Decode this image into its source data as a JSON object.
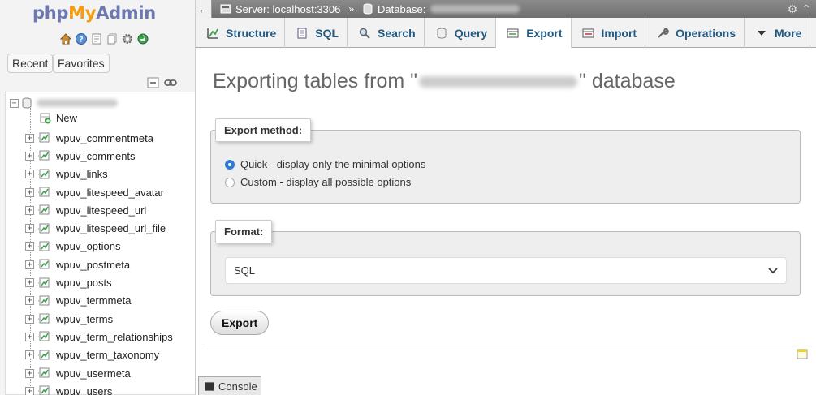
{
  "logo": {
    "php": "php",
    "my": "My",
    "admin": "Admin"
  },
  "quick_icons": [
    "home-icon",
    "help-icon",
    "docs-icon",
    "copy-icon",
    "settings-icon",
    "reload-icon"
  ],
  "nav": {
    "recent_label": "Recent",
    "favorites_label": "Favorites",
    "new_label": "New",
    "tables": [
      "wpuv_commentmeta",
      "wpuv_comments",
      "wpuv_links",
      "wpuv_litespeed_avatar",
      "wpuv_litespeed_url",
      "wpuv_litespeed_url_file",
      "wpuv_options",
      "wpuv_postmeta",
      "wpuv_posts",
      "wpuv_termmeta",
      "wpuv_terms",
      "wpuv_term_relationships",
      "wpuv_term_taxonomy",
      "wpuv_usermeta",
      "wpuv_users"
    ]
  },
  "breadcrumb": {
    "server": "Server: localhost:3306",
    "separator": "»",
    "database": "Database:"
  },
  "tabs": [
    {
      "label": "Structure",
      "icon": "structure-icon"
    },
    {
      "label": "SQL",
      "icon": "sql-icon"
    },
    {
      "label": "Search",
      "icon": "search-icon"
    },
    {
      "label": "Query",
      "icon": "query-icon"
    },
    {
      "label": "Export",
      "icon": "export-icon",
      "active": true
    },
    {
      "label": "Import",
      "icon": "import-icon"
    },
    {
      "label": "Operations",
      "icon": "wrench-icon"
    },
    {
      "label": "More",
      "icon": "caret-down-icon"
    }
  ],
  "main": {
    "title_prefix": "Exporting tables from \"",
    "title_suffix": "\" database",
    "export_method_legend": "Export method:",
    "quick_option": "Quick - display only the minimal options",
    "custom_option": "Custom - display all possible options",
    "format_legend": "Format:",
    "format_selected": "SQL",
    "export_button": "Export"
  },
  "console_label": "Console",
  "colors": {
    "link_blue": "#235a81",
    "logo_blue": "#6c78af",
    "logo_orange": "#f89c0e",
    "radio_checked": "#2d7bd6"
  }
}
